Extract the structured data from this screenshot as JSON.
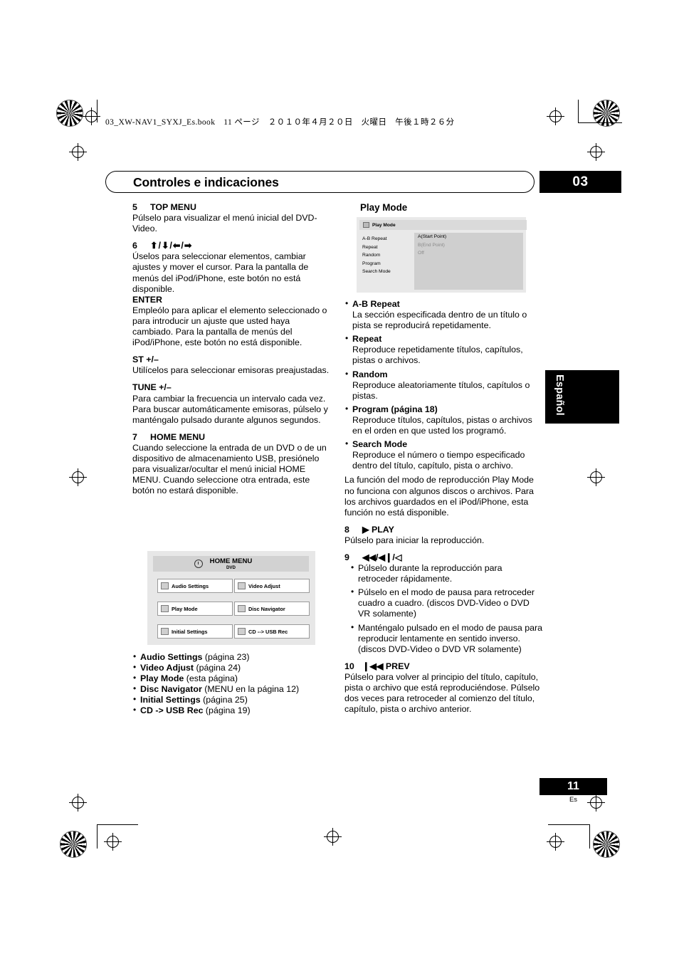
{
  "header": {
    "bookline": "03_XW-NAV1_SYXJ_Es.book　11 ページ　２０１０年４月２０日　火曜日　午後１時２６分",
    "title": "Controles e indicaciones",
    "chapter": "03",
    "side_tab": "Español",
    "page_number": "11",
    "page_lang": "Es"
  },
  "left_column": {
    "item5": {
      "num": "5",
      "label": "TOP MENU",
      "text": "Púlselo para visualizar el menú inicial del DVD-Video."
    },
    "item6": {
      "num": "6",
      "label": "⬆/⬇/⬅/➡",
      "text": "Úselos para seleccionar elementos, cambiar ajustes y mover el cursor. Para la pantalla de menús del iPod/iPhone, este botón no está disponible.",
      "enter_head": "ENTER",
      "enter_text": "Empleólo para aplicar el elemento seleccionado o para introducir un ajuste que usted haya cambiado. Para la pantalla de menús del iPod/iPhone, este botón no está disponible.",
      "st_head": "ST +/–",
      "st_text": "Utilícelos para seleccionar emisoras preajustadas.",
      "tune_head": "TUNE +/–",
      "tune_text": "Para cambiar la frecuencia un intervalo cada vez. Para buscar automáticamente emisoras, púlselo y manténgalo pulsado durante algunos segundos."
    },
    "item7": {
      "num": "7",
      "label": "HOME MENU",
      "text": "Cuando seleccione la entrada de un DVD o de un dispositivo de almacenamiento USB, presiónelo para visualizar/ocultar el menú inicial HOME MENU. Cuando seleccione otra entrada, este botón no estará disponible."
    },
    "home_menu_figure": {
      "title": "HOME MENU",
      "subtitle": "DVD",
      "cells": [
        "Audio Settings",
        "Video Adjust",
        "Play Mode",
        "Disc Navigator",
        "Initial Settings",
        "CD --> USB Rec"
      ]
    },
    "home_menu_list": [
      {
        "bold": "Audio Settings",
        "rest": " (página 23)"
      },
      {
        "bold": "Video Adjust",
        "rest": " (página 24)"
      },
      {
        "bold": "Play Mode",
        "rest": " (esta página)"
      },
      {
        "bold": "Disc Navigator",
        "rest": " (MENU en la página 12)"
      },
      {
        "bold": "Initial Settings",
        "rest": " (página 25)"
      },
      {
        "bold": "CD -> USB Rec",
        "rest": " (página 19)"
      }
    ]
  },
  "right_column": {
    "play_mode_head": "Play Mode",
    "play_mode_figure": {
      "bar_title": "Play Mode",
      "menu_items": [
        "A-B Repeat",
        "Repeat",
        "Random",
        "Program",
        "Search Mode"
      ],
      "pane_items": [
        "A(Start Point)",
        "B(End Point)",
        "Off"
      ]
    },
    "play_mode_list": [
      {
        "bold": "A-B Repeat",
        "text": "La sección especificada dentro de un título o pista se reproducirá repetidamente."
      },
      {
        "bold": "Repeat",
        "text": "Reproduce repetidamente títulos, capítulos, pistas o archivos."
      },
      {
        "bold": "Random",
        "text": "Reproduce aleatoriamente títulos, capítulos o pistas."
      },
      {
        "bold": "Program (página 18)",
        "text": "Reproduce títulos, capítulos, pistas o archivos en el orden en que usted los programó."
      },
      {
        "bold": "Search Mode",
        "text": "Reproduce el número o tiempo especificado dentro del título, capítulo, pista o archivo."
      }
    ],
    "play_mode_note": "La función del modo de reproducción Play Mode no funciona con algunos discos o archivos. Para los archivos guardados en el iPod/iPhone, esta función no está disponible.",
    "item8": {
      "num": "8",
      "label": "▶ PLAY",
      "text": "Púlselo para iniciar la reproducción."
    },
    "item9": {
      "num": "9",
      "label": "◀◀/◀❙/◁",
      "bullets": [
        "Púlselo durante la reproducción para retroceder rápidamente.",
        "Púlselo en el modo de pausa para retroceder cuadro a cuadro. (discos DVD-Video o DVD VR solamente)",
        "Manténgalo pulsado en el modo de pausa para reproducir lentamente en sentido inverso. (discos DVD-Video o DVD VR solamente)"
      ]
    },
    "item10": {
      "num": "10",
      "label": "❙◀◀ PREV",
      "text": "Púlselo para volver al principio del título, capítulo, pista o archivo que está reproduciéndose. Púlselo dos veces para retroceder al comienzo del título, capítulo, pista o archivo anterior."
    }
  }
}
